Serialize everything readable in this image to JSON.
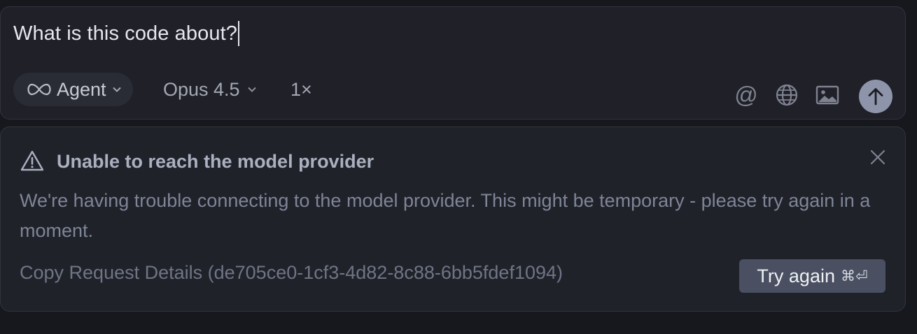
{
  "composer": {
    "prompt_text": "What is this code about?",
    "mode": {
      "label": "Agent",
      "icon": "infinity-icon"
    },
    "model": {
      "label": "Opus 4.5"
    },
    "multiplier": "1×",
    "tools": {
      "mention_symbol": "@",
      "icons": [
        "at-icon",
        "globe-icon",
        "image-icon",
        "arrow-up-icon"
      ]
    },
    "send_button_color": "#8e95ab"
  },
  "error": {
    "title": "Unable to reach the model provider",
    "message": "We're having trouble connecting to the model provider. This might be temporary - please try again in a moment.",
    "copy_details": "Copy Request Details (de705ce0-1cf3-4d82-8c88-6bb5fdef1094)",
    "retry_label": "Try again",
    "retry_shortcut": "⌘⏎",
    "icons": [
      "warning-icon",
      "close-icon"
    ]
  }
}
